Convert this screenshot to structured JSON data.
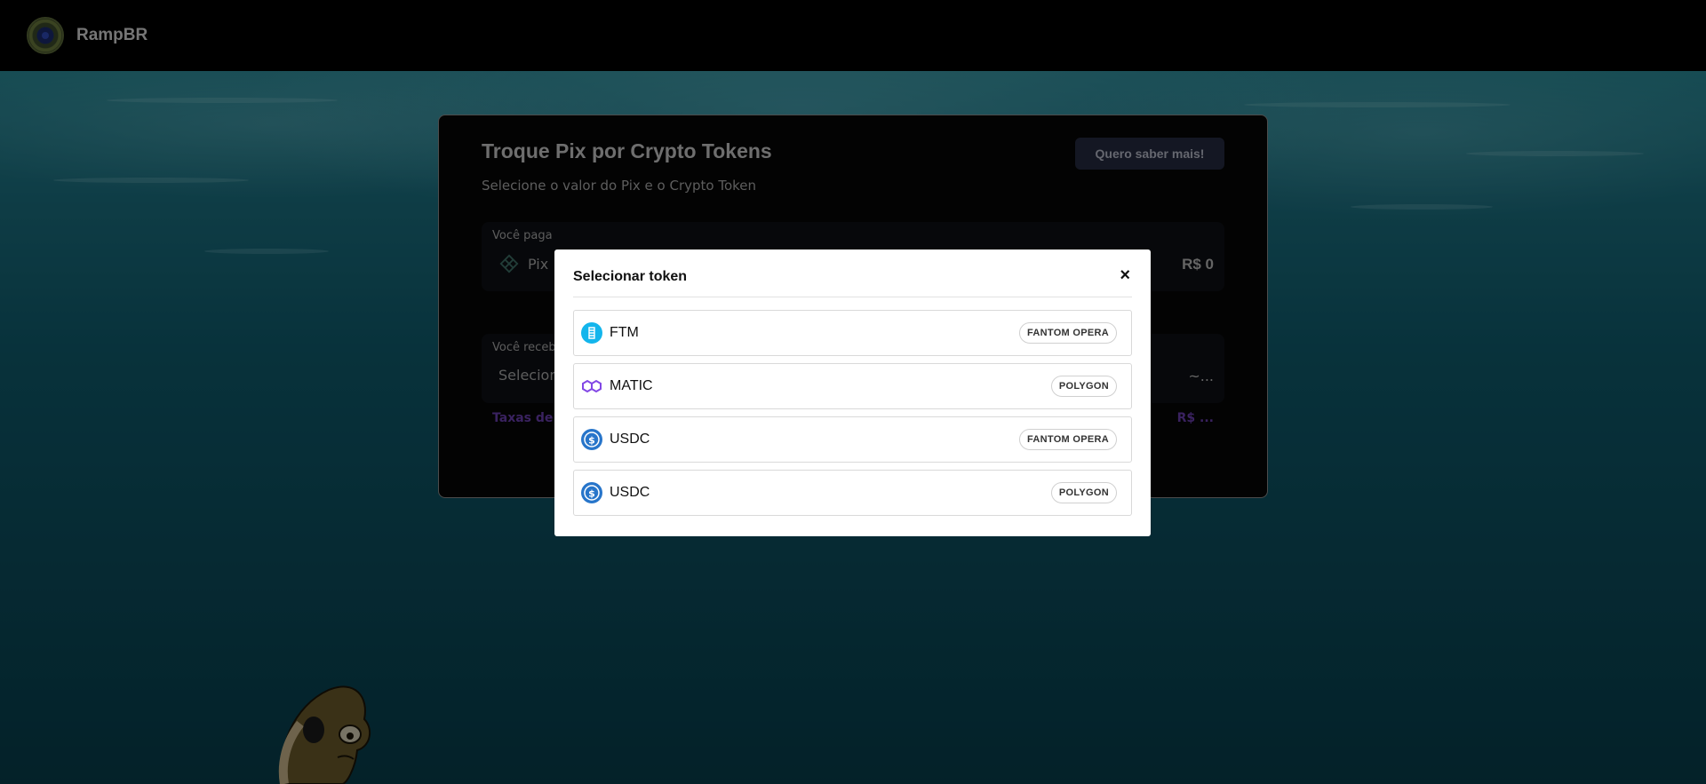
{
  "navbar": {
    "brand": "RampBR"
  },
  "card": {
    "title": "Troque Pix por Crypto Tokens",
    "subtitle": "Selecione o valor do Pix e o Crypto Token",
    "more_button": "Quero saber mais!",
    "pay": {
      "label": "Você paga",
      "method": "Pix",
      "amount": "R$ 0"
    },
    "receive": {
      "label": "Você receb",
      "select": "Selecion",
      "amount": "~..."
    },
    "fees": {
      "label": "Taxas de s",
      "value": "R$ ..."
    }
  },
  "modal": {
    "title": "Selecionar token",
    "close": "×",
    "tokens": [
      {
        "symbol": "FTM",
        "network": "FANTOM OPERA",
        "icon": "fantom-icon",
        "color": "#13b5ec"
      },
      {
        "symbol": "MATIC",
        "network": "POLYGON",
        "icon": "polygon-icon",
        "color": "#8247e5"
      },
      {
        "symbol": "USDC",
        "network": "FANTOM OPERA",
        "icon": "usdc-icon",
        "color": "#2775ca"
      },
      {
        "symbol": "USDC",
        "network": "POLYGON",
        "icon": "usdc-icon",
        "color": "#2775ca"
      }
    ]
  }
}
